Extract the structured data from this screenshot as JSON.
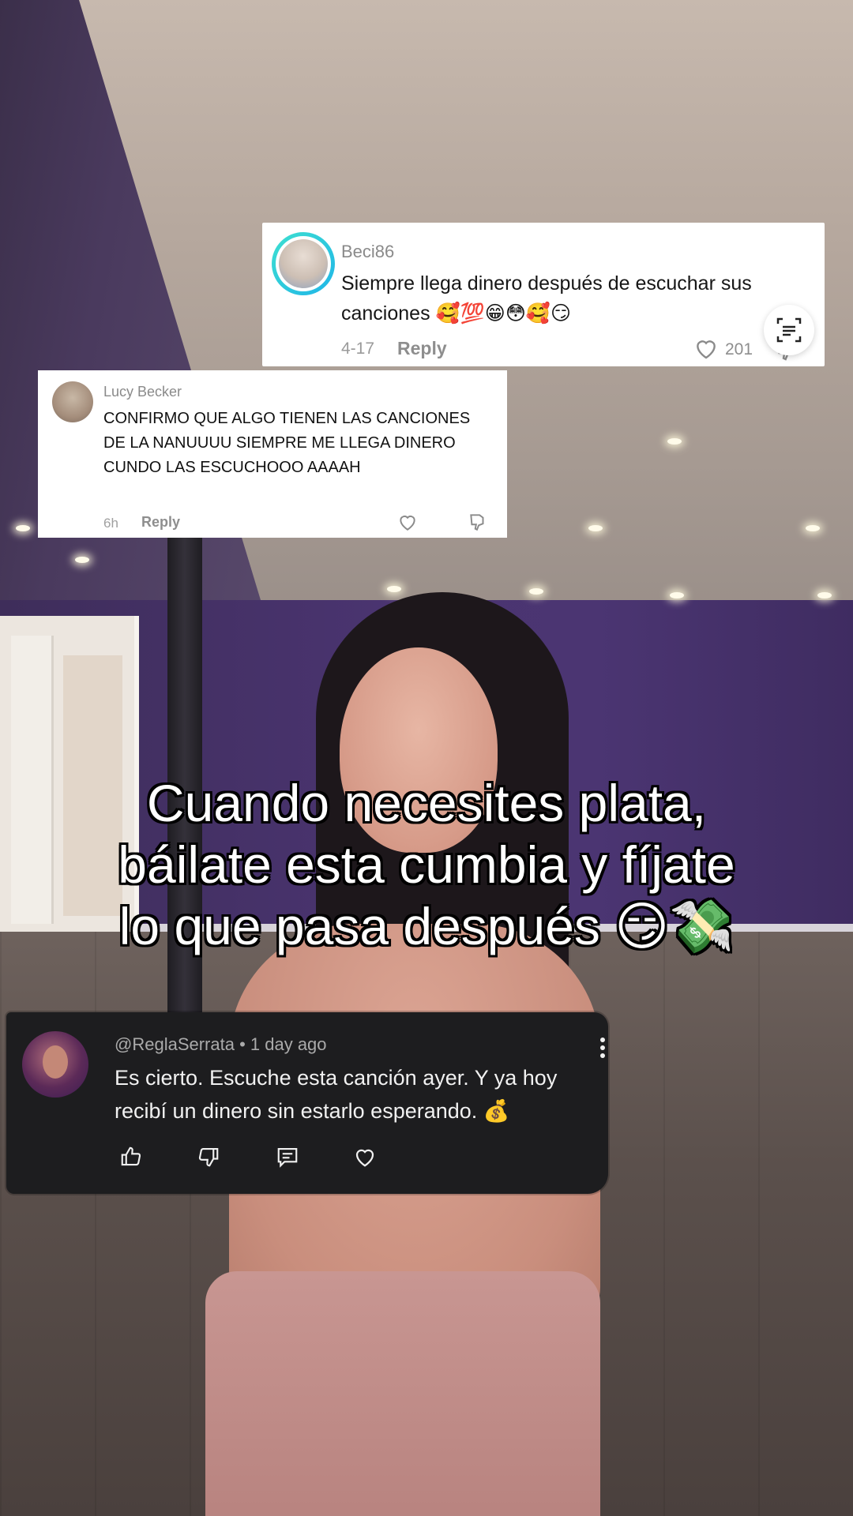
{
  "caption": {
    "line1": "Cuando necesites plata,",
    "line2": "báilate esta cumbia y fíjate",
    "line3": "lo que pasa después 😏💸"
  },
  "comment_beci": {
    "username": "Beci86",
    "text": "Siempre llega dinero después de escuchar sus canciones 🥰💯😁😳🥰😏",
    "date": "4-17",
    "reply_label": "Reply",
    "likes": "201",
    "icons": [
      "heart-icon",
      "dislike-icon",
      "text-scan-icon"
    ]
  },
  "comment_lucy": {
    "username": "Lucy Becker",
    "text": "CONFIRMO QUE ALGO TIENEN LAS CANCIONES DE LA NANUUUU SIEMPRE ME LLEGA DINERO CUNDO LAS ESCUCHOOO AAAAH",
    "time": "6h",
    "reply_label": "Reply",
    "icons": [
      "heart-icon",
      "dislike-icon"
    ]
  },
  "comment_regla": {
    "header": "@ReglaSerrata • 1 day ago",
    "text": "Es cierto.  Escuche esta canción ayer. Y ya hoy recibí un dinero sin estarlo esperando. 💰",
    "icons": [
      "thumbs-up-icon",
      "thumbs-down-icon",
      "reply-icon",
      "heart-icon",
      "more-icon"
    ]
  },
  "colors": {
    "card_light": "#ffffff",
    "card_dark": "#1d1d1f",
    "avatar_ring": "#1fb5e8",
    "wall_purple": "#4a3470"
  }
}
